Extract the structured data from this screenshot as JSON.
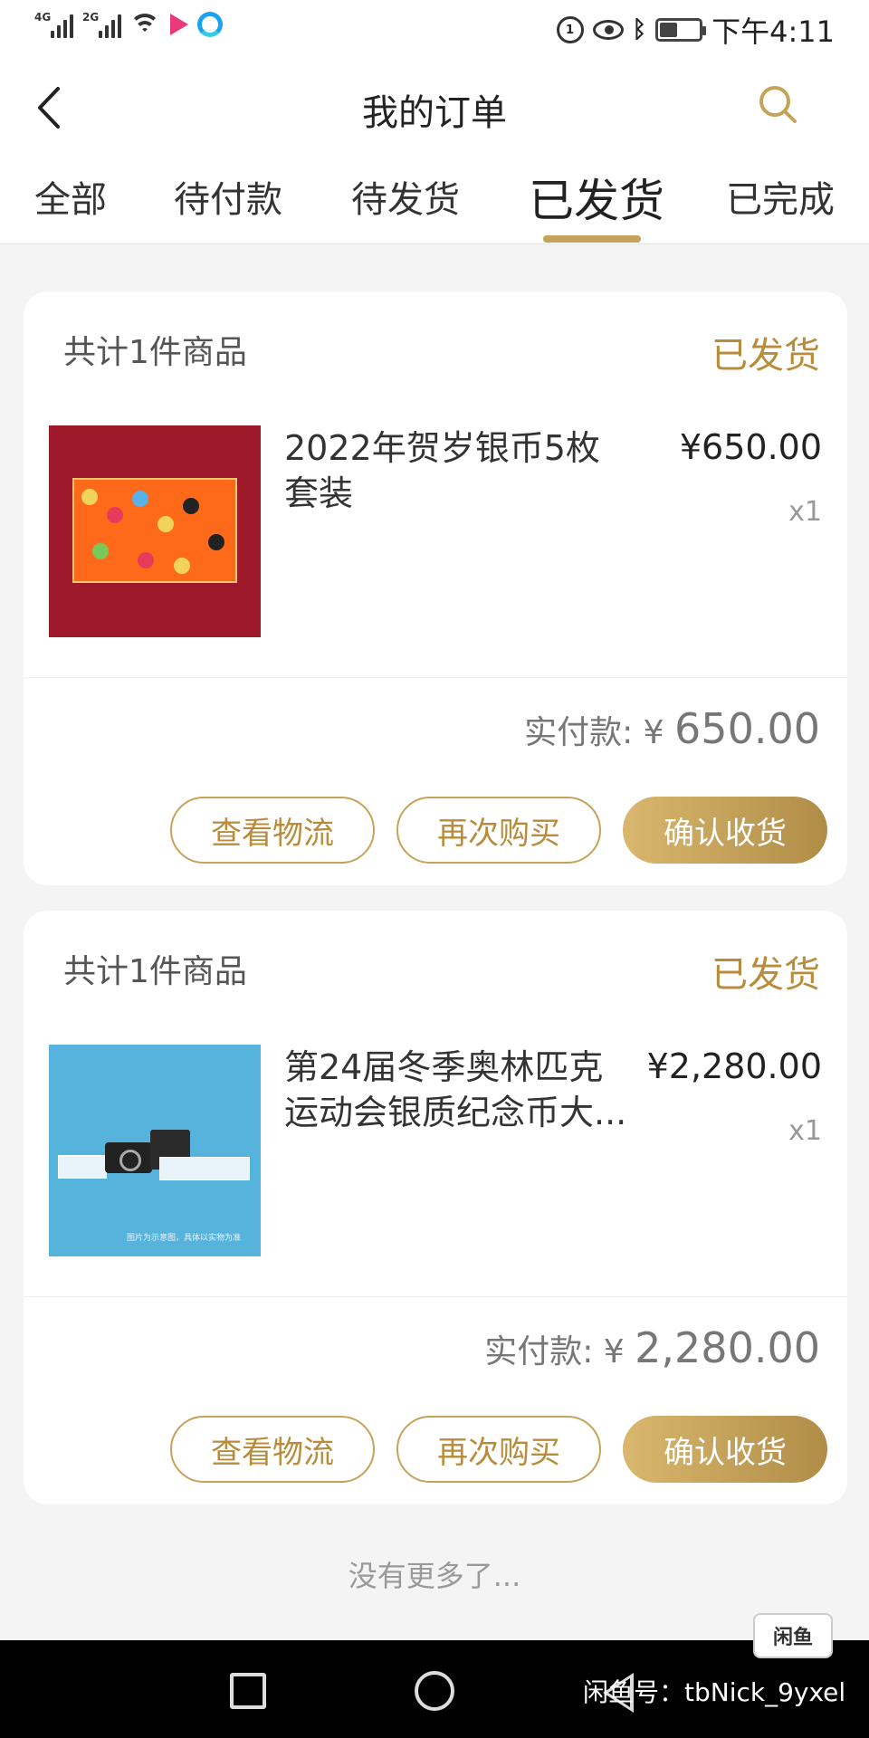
{
  "status_bar": {
    "network_1": "4G",
    "network_2": "2G",
    "time": "下午4:11",
    "indicator": "1"
  },
  "header": {
    "title": "我的订单"
  },
  "tabs": [
    {
      "label": "全部",
      "active": false
    },
    {
      "label": "待付款",
      "active": false
    },
    {
      "label": "待发货",
      "active": false
    },
    {
      "label": "已发货",
      "active": true
    },
    {
      "label": "已完成",
      "active": false
    }
  ],
  "orders": [
    {
      "count_text": "共计1件商品",
      "status": "已发货",
      "product_name": "2022年贺岁银币5枚套装",
      "price": "¥650.00",
      "quantity": "x1",
      "paid_label": "实付款: ¥ ",
      "paid_amount": "650.00",
      "buttons": [
        "查看物流",
        "再次购买",
        "确认收货"
      ]
    },
    {
      "count_text": "共计1件商品",
      "status": "已发货",
      "product_name": "第24届冬季奥林匹克运动会银质纪念币大...",
      "price": "¥2,280.00",
      "quantity": "x1",
      "paid_label": "实付款: ¥ ",
      "paid_amount": "2,280.00",
      "buttons": [
        "查看物流",
        "再次购买",
        "确认收货"
      ],
      "image_caption": "图片为示意图，具体以实物为准"
    }
  ],
  "footer": {
    "no_more": "没有更多了..."
  },
  "watermark": {
    "text": "闲鱼号：tbNick_9yxel",
    "badge": "闲鱼"
  },
  "colors": {
    "accent": "#b88c3a",
    "accent_light": "#d9b76e",
    "background": "#f4f4f4"
  }
}
